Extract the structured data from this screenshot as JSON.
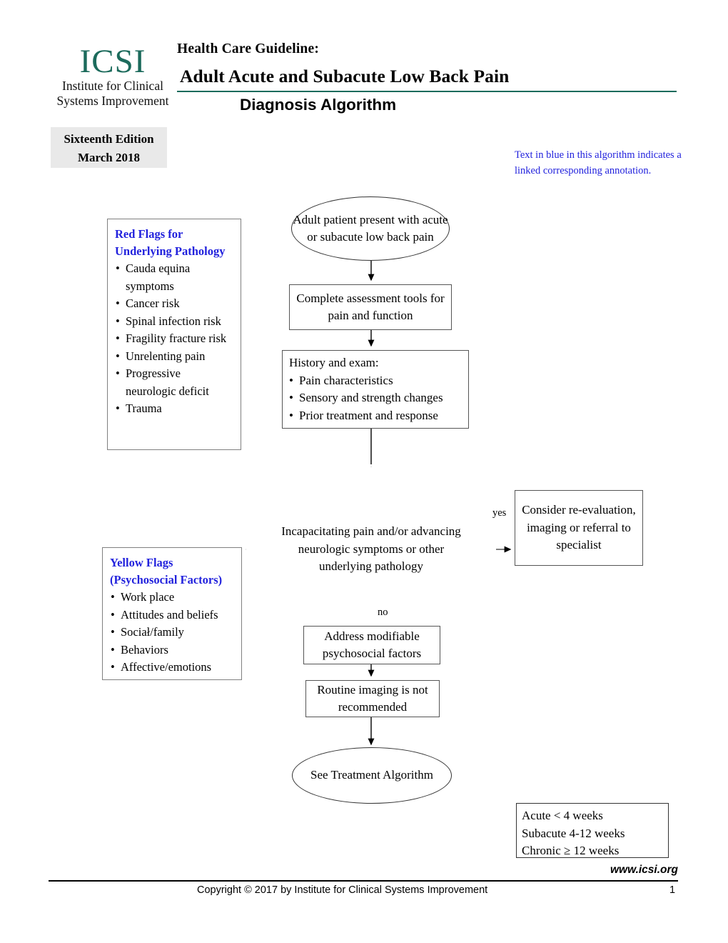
{
  "header": {
    "logo_mark": "ICSI",
    "logo_line1": "Institute for Clinical",
    "logo_line2": "Systems Improvement",
    "logo_color": "#1c6b5c",
    "guideline_label": "Health Care Guideline:",
    "title": "Adult Acute and Subacute Low Back Pain",
    "subtitle": "Diagnosis Algorithm",
    "edition": "Sixteenth Edition",
    "edition_date": "March 2018",
    "blue_note": "Text in blue in this algorithm indicates a linked corresponding annotation.",
    "blue_note_color": "#2222dd"
  },
  "side_boxes": {
    "red_flags": {
      "title": "Red Flags for Underlying Pathology",
      "items": [
        "Cauda equina symptoms",
        "Cancer risk",
        "Spinal infection risk",
        "Fragility fracture risk",
        "Unrelenting pain",
        "Progressive neurologic deficit",
        "Trauma"
      ]
    },
    "yellow_flags": {
      "title": "Yellow Flags (Psychosocial Factors)",
      "items": [
        "Work place",
        "Attitudes and beliefs",
        "Sociał/family",
        "Behaviors",
        "Affective/emotions"
      ]
    }
  },
  "flow": {
    "start": "Adult patient present with acute or subacute low back pain",
    "assessment": "Complete assessment tools for pain and function",
    "history_title": "History and exam:",
    "history_items": [
      "Pain characteristics",
      "Sensory and strength changes",
      "Prior treatment and response"
    ],
    "decision": "Incapacitating pain and/or advancing neurologic symptoms or other underlying pathology",
    "specialist": "Consider re-evaluation, imaging or referral to specialist",
    "address": "Address modifiable psychosocial factors",
    "routine": "Routine imaging is not recommended",
    "end": "See Treatment Algorithm",
    "label_yes": "yes",
    "label_no": "no"
  },
  "legend": {
    "line1": "Acute < 4 weeks",
    "line2": "Subacute 4-12 weeks",
    "line3": "Chronic ≥ 12 weeks"
  },
  "footer": {
    "site": "www.icsi.org",
    "copyright": "Copyright © 2017 by Institute for Clinical Systems Improvement",
    "page": "1"
  }
}
